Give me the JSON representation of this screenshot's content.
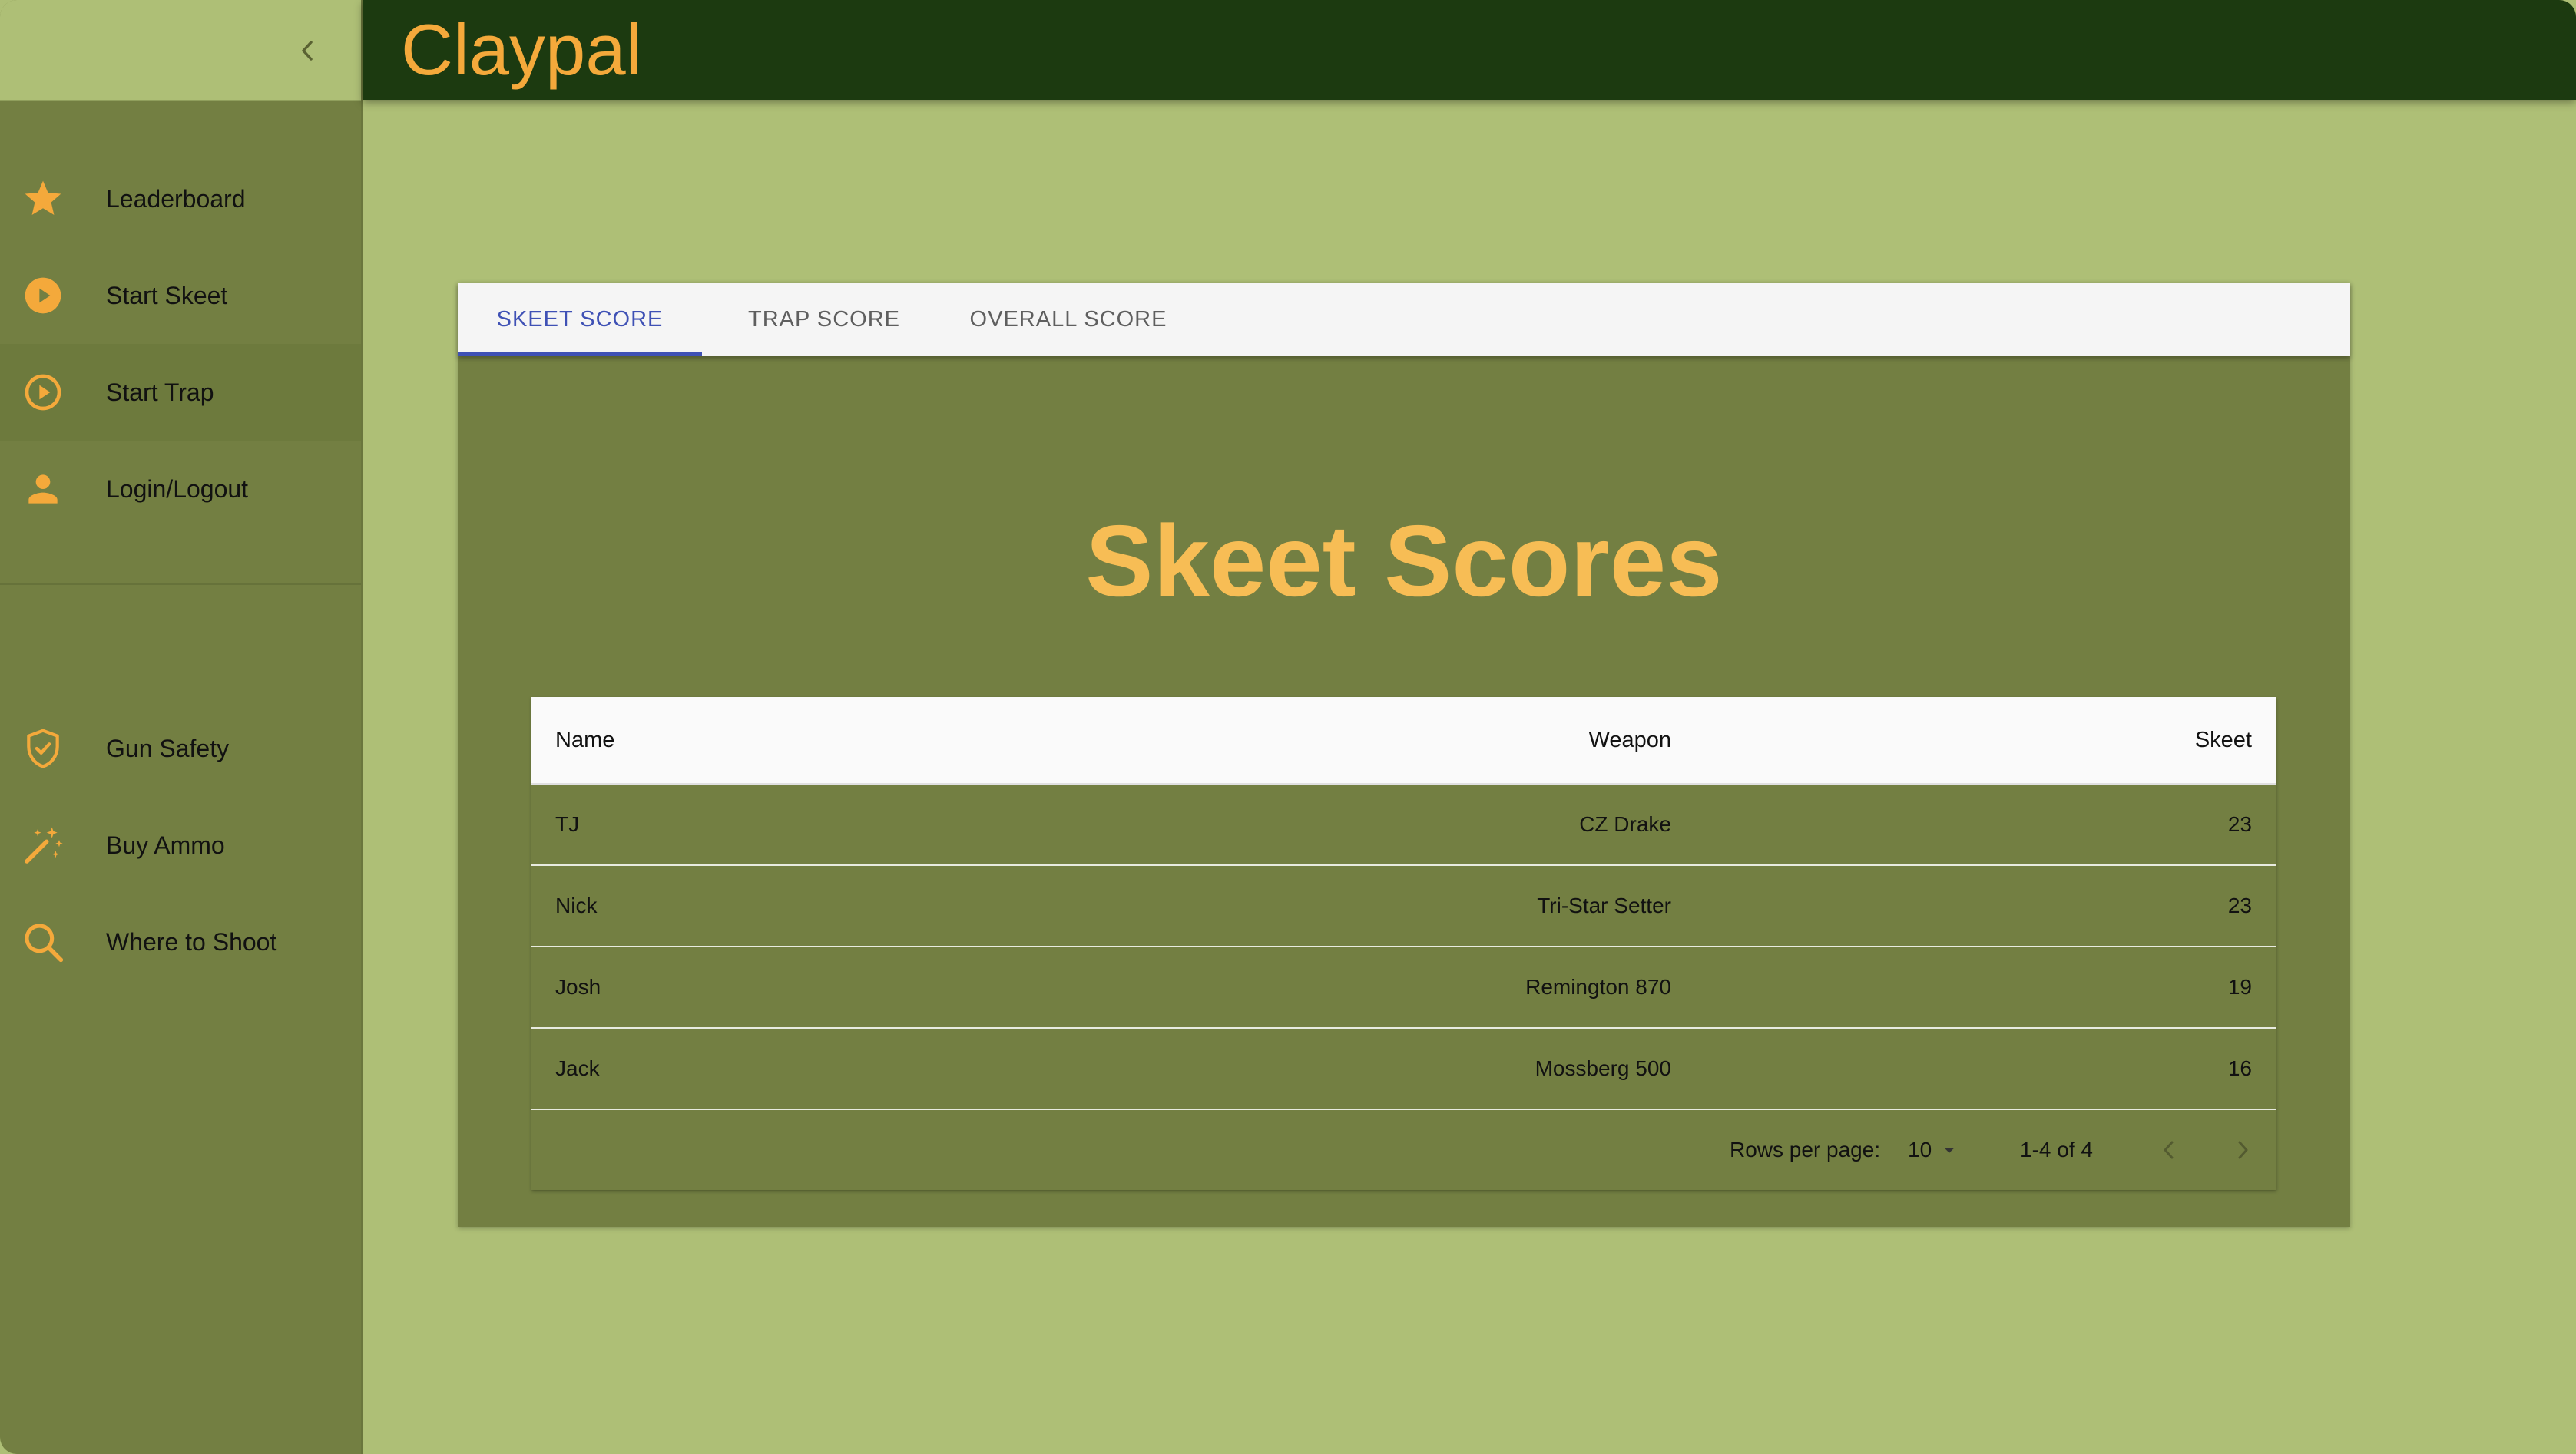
{
  "app": {
    "title": "Claypal"
  },
  "colors": {
    "accent": "#f4a93b",
    "topbar": "#1c3a10",
    "sidebar": "#737f42",
    "page": "#aebf76",
    "tab_active": "#3f51b5"
  },
  "sidebar": {
    "collapse_icon": "chevron-left-icon",
    "items": [
      {
        "label": "Leaderboard",
        "icon": "star-icon"
      },
      {
        "label": "Start Skeet",
        "icon": "play-circle-filled-icon"
      },
      {
        "label": "Start Trap",
        "icon": "play-circle-outline-icon",
        "active": true
      },
      {
        "label": "Login/Logout",
        "icon": "person-icon"
      }
    ],
    "secondary_items": [
      {
        "label": "Gun Safety",
        "icon": "shield-check-icon"
      },
      {
        "label": "Buy Ammo",
        "icon": "magic-wand-icon"
      },
      {
        "label": "Where to Shoot",
        "icon": "search-icon"
      }
    ]
  },
  "tabs": [
    {
      "label": "SKEET SCORE",
      "active": true
    },
    {
      "label": "TRAP SCORE"
    },
    {
      "label": "OVERALL SCORE"
    }
  ],
  "main": {
    "heading": "Skeet Scores"
  },
  "table": {
    "columns": [
      "Name",
      "Weapon",
      "Skeet"
    ],
    "rows": [
      [
        "TJ",
        "CZ Drake",
        "23"
      ],
      [
        "Nick",
        "Tri-Star Setter",
        "23"
      ],
      [
        "Josh",
        "Remington 870",
        "19"
      ],
      [
        "Jack",
        "Mossberg 500",
        "16"
      ]
    ]
  },
  "pagination": {
    "rows_per_page_label": "Rows per page:",
    "rows_per_page_value": "10",
    "range": "1-4 of 4"
  }
}
